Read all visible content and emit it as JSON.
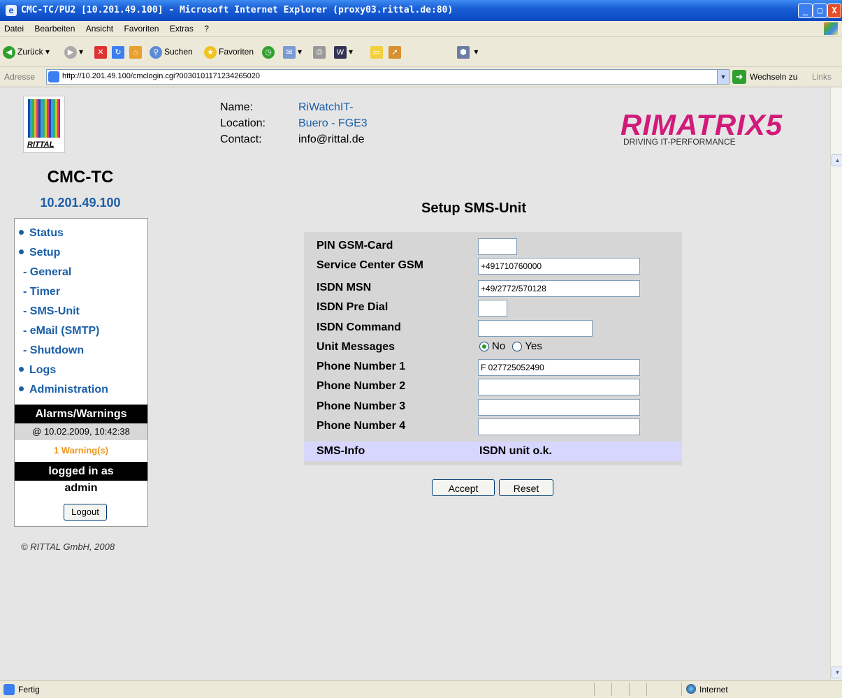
{
  "window": {
    "title": "CMC-TC/PU2 [10.201.49.100] - Microsoft Internet Explorer (proxy03.rittal.de:80)",
    "controls": [
      "_",
      "□",
      "X"
    ]
  },
  "menu": [
    "Datei",
    "Bearbeiten",
    "Ansicht",
    "Favoriten",
    "Extras",
    "?"
  ],
  "toolbar": {
    "back": "Zurück",
    "search": "Suchen",
    "favorites": "Favoriten"
  },
  "address": {
    "label": "Adresse",
    "url": "http://10.201.49.100/cmclogin.cgi?0030101171234265020",
    "go": "Wechseln zu",
    "links": "Links"
  },
  "header": {
    "logo_text": "RITTAL",
    "name_label": "Name:",
    "name_value": "RiWatchIT-",
    "location_label": "Location:",
    "location_value": "Buero - FGE3",
    "contact_label": "Contact:",
    "contact_value": "info@rittal.de",
    "brand": "RIMATRIX5",
    "brand_tagline": "DRIVING IT-PERFORMANCE",
    "accent_color": "#d11a7a"
  },
  "sidebar": {
    "device": "CMC-TC",
    "ip": "10.201.49.100",
    "items": {
      "status": "Status",
      "setup": "Setup",
      "general": "- General",
      "timer": "- Timer",
      "sms_unit": "- SMS-Unit",
      "email": "- eMail (SMTP)",
      "shutdown": "- Shutdown",
      "logs": "Logs",
      "administration": "Administration"
    },
    "alarms_heading": "Alarms/Warnings",
    "alarm_time": "@ 10.02.2009, 10:42:38",
    "warning_text": "1 Warning(s)",
    "logged_heading": "logged in as",
    "user": "admin",
    "logout": "Logout",
    "copyright": "© RITTAL GmbH, 2008"
  },
  "form": {
    "heading": "Setup SMS-Unit",
    "pin_label": "PIN GSM-Card",
    "pin_value": "",
    "service_label": "Service Center GSM",
    "service_value": "+491710760000",
    "msn_label": "ISDN MSN",
    "msn_value": "+49/2772/570128",
    "predial_label": "ISDN Pre Dial",
    "predial_value": "",
    "command_label": "ISDN Command",
    "command_value": "",
    "unit_label": "Unit Messages",
    "unit_no": "No",
    "unit_yes": "Yes",
    "unit_selected": "No",
    "phone1_label": "Phone Number 1",
    "phone1_value": "F 027725052490",
    "phone2_label": "Phone Number 2",
    "phone2_value": "",
    "phone3_label": "Phone Number 3",
    "phone3_value": "",
    "phone4_label": "Phone Number 4",
    "phone4_value": "",
    "info_label": "SMS-Info",
    "info_value": "ISDN unit o.k.",
    "accept": "Accept",
    "reset": "Reset"
  },
  "statusbar": {
    "status": "Fertig",
    "zone": "Internet"
  }
}
